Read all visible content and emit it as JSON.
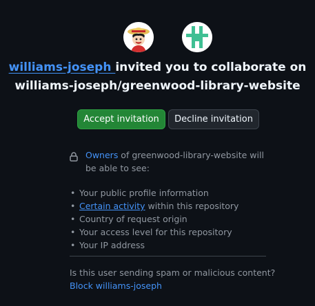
{
  "inviter": {
    "username": "williams-joseph",
    "avatar_icon": "anime-pirate-avatar"
  },
  "repository": {
    "avatar_icon": "identicon-hash-green",
    "accent_color": "#3fbf93"
  },
  "headline": {
    "inviter_link": "williams-joseph ",
    "middle_text": "invited you to collaborate on",
    "repo_full_name": "williams-joseph/greenwood-library-website"
  },
  "actions": {
    "accept_label": "Accept invitation",
    "decline_label": "Decline invitation"
  },
  "visibility": {
    "owners_link": "Owners",
    "intro_rest": " of greenwood-library-website will be able to see:",
    "items": [
      {
        "text": "Your public profile information"
      },
      {
        "link": "Certain activity",
        "text": " within this repository"
      },
      {
        "text": "Country of request origin"
      },
      {
        "text": "Your access level for this repository"
      },
      {
        "text": "Your IP address"
      }
    ]
  },
  "spam": {
    "question": "Is this user sending spam or malicious content?",
    "block_link": "Block williams-joseph"
  },
  "colors": {
    "background": "#0d1117",
    "link": "#4493f8",
    "accept_button": "#238636",
    "decline_button": "#21262d",
    "muted_text": "#9198a1"
  }
}
